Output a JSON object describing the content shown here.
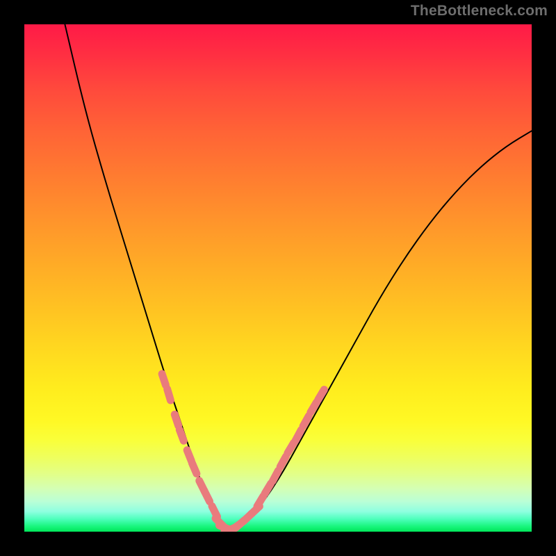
{
  "watermark": "TheBottleneck.com",
  "chart_data": {
    "type": "line",
    "title": "",
    "xlabel": "",
    "ylabel": "",
    "xlim": [
      0,
      100
    ],
    "ylim": [
      0,
      100
    ],
    "grid": false,
    "legend": false,
    "note": "Values estimated from pixel positions; axes unlabeled so units are 0–100 normalized.",
    "series": [
      {
        "name": "main_curve",
        "color": "#000000",
        "x": [
          8,
          12,
          16,
          20,
          24,
          28,
          30,
          32,
          34,
          36,
          38,
          39,
          40,
          42,
          45,
          50,
          55,
          60,
          65,
          70,
          75,
          80,
          85,
          90,
          95,
          100
        ],
        "y": [
          100,
          83,
          69,
          56,
          43,
          30,
          24,
          18,
          12,
          7,
          3,
          1,
          0,
          1,
          3,
          10,
          19,
          28,
          37,
          46,
          54,
          61,
          67,
          72,
          76,
          79
        ]
      },
      {
        "name": "lower_markers_left",
        "color": "#e97b7d",
        "marker": "capsule",
        "x": [
          27.5,
          28.5,
          30.0,
          31.0,
          32.5,
          33.5,
          35.0,
          36.0,
          37.5
        ],
        "y": [
          30.0,
          27.0,
          22.0,
          19.0,
          15.0,
          12.5,
          9.0,
          7.0,
          4.0
        ]
      },
      {
        "name": "lower_markers_valley",
        "color": "#e97b7d",
        "marker": "capsule",
        "x": [
          38.5,
          39.5,
          40.5,
          41.5,
          42.5,
          44.0,
          45.5
        ],
        "y": [
          1.8,
          0.8,
          0.4,
          0.8,
          1.5,
          2.8,
          4.2
        ]
      },
      {
        "name": "lower_markers_right",
        "color": "#e97b7d",
        "marker": "capsule",
        "x": [
          46.5,
          48.0,
          49.5,
          51.0,
          52.5,
          54.0,
          55.5,
          57.0,
          58.5
        ],
        "y": [
          6.0,
          8.5,
          11.0,
          13.8,
          16.5,
          19.0,
          21.8,
          24.5,
          27.0
        ]
      }
    ],
    "gradient_bands": [
      {
        "y_pct": 0,
        "color": "#ff1a47"
      },
      {
        "y_pct": 50,
        "color": "#ffb924"
      },
      {
        "y_pct": 80,
        "color": "#fffb2a"
      },
      {
        "y_pct": 100,
        "color": "#00e65a"
      }
    ]
  }
}
